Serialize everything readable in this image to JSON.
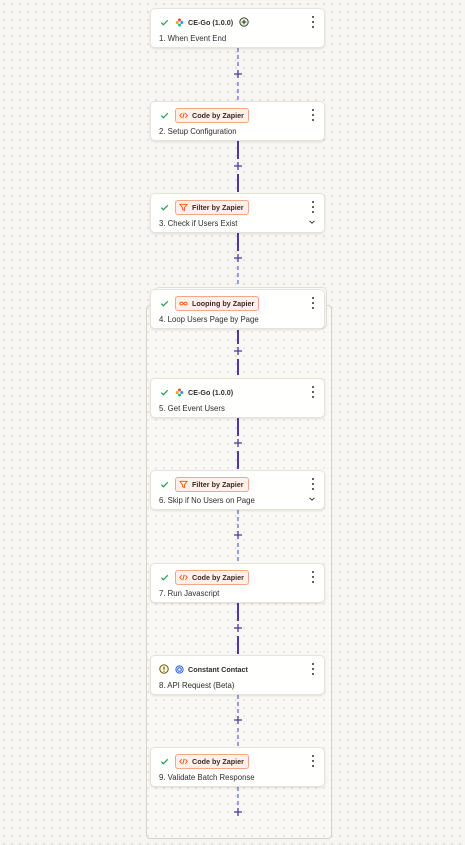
{
  "steps": [
    {
      "id": 1,
      "app": "CE-Go (1.0.0)",
      "title": "1. When Event End",
      "status": "success",
      "icon": "ce-go-icon",
      "pill": false,
      "add_badge": true,
      "chevron": false
    },
    {
      "id": 2,
      "app": "Code by Zapier",
      "title": "2. Setup Configuration",
      "status": "success",
      "icon": "code-icon",
      "pill": true,
      "add_badge": false,
      "chevron": false
    },
    {
      "id": 3,
      "app": "Filter by Zapier",
      "title": "3. Check if Users Exist",
      "status": "success",
      "icon": "filter-icon",
      "pill": true,
      "add_badge": false,
      "chevron": true
    },
    {
      "id": 4,
      "app": "Looping by Zapier",
      "title": "4. Loop Users Page by Page",
      "status": "success",
      "icon": "loop-icon",
      "pill": true,
      "add_badge": false,
      "chevron": false
    },
    {
      "id": 5,
      "app": "CE-Go (1.0.0)",
      "title": "5. Get Event Users",
      "status": "success",
      "icon": "ce-go-icon",
      "pill": false,
      "add_badge": false,
      "chevron": false
    },
    {
      "id": 6,
      "app": "Filter by Zapier",
      "title": "6. Skip if No Users on Page",
      "status": "success",
      "icon": "filter-icon",
      "pill": true,
      "add_badge": false,
      "chevron": true
    },
    {
      "id": 7,
      "app": "Code by Zapier",
      "title": "7. Run Javascript",
      "status": "success",
      "icon": "code-icon",
      "pill": true,
      "add_badge": false,
      "chevron": false
    },
    {
      "id": 8,
      "app": "Constant Contact",
      "title": "8. API Request (Beta)",
      "status": "warning",
      "icon": "constant-contact-icon",
      "pill": false,
      "add_badge": false,
      "chevron": false
    },
    {
      "id": 9,
      "app": "Code by Zapier",
      "title": "9. Validate Batch Response",
      "status": "success",
      "icon": "code-icon",
      "pill": true,
      "add_badge": false,
      "chevron": false
    }
  ],
  "colors": {
    "success": "#1f9d55",
    "warning": "#8a6d00",
    "accent": "#4b3a9a",
    "pill_border": "#f6a585",
    "pill_bg": "#fff1ea",
    "icon_orange": "#ff4f00"
  },
  "connector_icon": "plus-icon"
}
